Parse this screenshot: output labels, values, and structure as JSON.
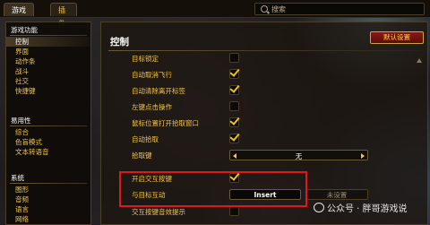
{
  "tabs": [
    {
      "label": "游戏",
      "active": true
    },
    {
      "label": "插件",
      "active": false
    }
  ],
  "search": {
    "placeholder": "搜索"
  },
  "sidebar": {
    "sections": [
      {
        "title": "游戏功能",
        "items": [
          {
            "label": "控制",
            "selected": true
          },
          {
            "label": "界面",
            "selected": false
          },
          {
            "label": "动作条",
            "selected": false
          },
          {
            "label": "战斗",
            "selected": false
          },
          {
            "label": "社交",
            "selected": false
          },
          {
            "label": "快捷键",
            "selected": false
          }
        ]
      },
      {
        "title": "易用性",
        "items": [
          {
            "label": "综合",
            "selected": false
          },
          {
            "label": "色盲模式",
            "selected": false
          },
          {
            "label": "文本转语音",
            "selected": false
          }
        ]
      },
      {
        "title": "系统",
        "items": [
          {
            "label": "图形",
            "selected": false
          },
          {
            "label": "音频",
            "selected": false
          },
          {
            "label": "语言",
            "selected": false
          },
          {
            "label": "网络",
            "selected": false
          }
        ]
      }
    ]
  },
  "panel": {
    "title": "控制",
    "defaults_button": "默认设置",
    "settings": [
      {
        "label": "目标锁定",
        "type": "checkbox",
        "checked": false
      },
      {
        "label": "自动取消飞行",
        "type": "checkbox",
        "checked": true
      },
      {
        "label": "自动清除离开标签",
        "type": "checkbox",
        "checked": true
      },
      {
        "label": "左键点击操作",
        "type": "checkbox",
        "checked": false
      },
      {
        "label": "鼠标位置打开拾取窗口",
        "type": "checkbox",
        "checked": true
      },
      {
        "label": "自动拾取",
        "type": "checkbox",
        "checked": true
      },
      {
        "label": "拾取键",
        "type": "dropdown",
        "value": "无"
      },
      {
        "label": "开启交互按键",
        "type": "checkbox",
        "checked": true
      },
      {
        "label": "与目标互动",
        "type": "keybind",
        "primary": "Insert",
        "secondary": "未设置"
      },
      {
        "label": "交互按键音效提示",
        "type": "checkbox",
        "checked": false
      }
    ]
  },
  "watermark": {
    "text": "公众号 · 胖哥游戏说"
  },
  "colors": {
    "accent_gold": "#f3c64a",
    "highlight_red": "#e01818",
    "defaults_red": "#8a1a12"
  }
}
